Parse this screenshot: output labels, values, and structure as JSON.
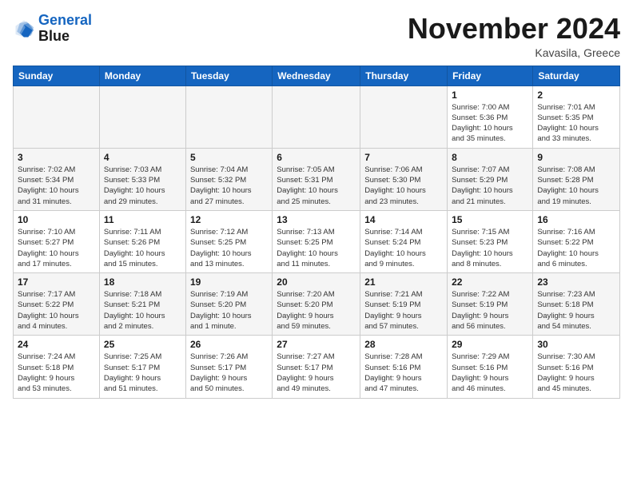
{
  "header": {
    "logo_line1": "General",
    "logo_line2": "Blue",
    "month": "November 2024",
    "location": "Kavasila, Greece"
  },
  "weekdays": [
    "Sunday",
    "Monday",
    "Tuesday",
    "Wednesday",
    "Thursday",
    "Friday",
    "Saturday"
  ],
  "weeks": [
    [
      {
        "day": "",
        "info": ""
      },
      {
        "day": "",
        "info": ""
      },
      {
        "day": "",
        "info": ""
      },
      {
        "day": "",
        "info": ""
      },
      {
        "day": "",
        "info": ""
      },
      {
        "day": "1",
        "info": "Sunrise: 7:00 AM\nSunset: 5:36 PM\nDaylight: 10 hours\nand 35 minutes."
      },
      {
        "day": "2",
        "info": "Sunrise: 7:01 AM\nSunset: 5:35 PM\nDaylight: 10 hours\nand 33 minutes."
      }
    ],
    [
      {
        "day": "3",
        "info": "Sunrise: 7:02 AM\nSunset: 5:34 PM\nDaylight: 10 hours\nand 31 minutes."
      },
      {
        "day": "4",
        "info": "Sunrise: 7:03 AM\nSunset: 5:33 PM\nDaylight: 10 hours\nand 29 minutes."
      },
      {
        "day": "5",
        "info": "Sunrise: 7:04 AM\nSunset: 5:32 PM\nDaylight: 10 hours\nand 27 minutes."
      },
      {
        "day": "6",
        "info": "Sunrise: 7:05 AM\nSunset: 5:31 PM\nDaylight: 10 hours\nand 25 minutes."
      },
      {
        "day": "7",
        "info": "Sunrise: 7:06 AM\nSunset: 5:30 PM\nDaylight: 10 hours\nand 23 minutes."
      },
      {
        "day": "8",
        "info": "Sunrise: 7:07 AM\nSunset: 5:29 PM\nDaylight: 10 hours\nand 21 minutes."
      },
      {
        "day": "9",
        "info": "Sunrise: 7:08 AM\nSunset: 5:28 PM\nDaylight: 10 hours\nand 19 minutes."
      }
    ],
    [
      {
        "day": "10",
        "info": "Sunrise: 7:10 AM\nSunset: 5:27 PM\nDaylight: 10 hours\nand 17 minutes."
      },
      {
        "day": "11",
        "info": "Sunrise: 7:11 AM\nSunset: 5:26 PM\nDaylight: 10 hours\nand 15 minutes."
      },
      {
        "day": "12",
        "info": "Sunrise: 7:12 AM\nSunset: 5:25 PM\nDaylight: 10 hours\nand 13 minutes."
      },
      {
        "day": "13",
        "info": "Sunrise: 7:13 AM\nSunset: 5:25 PM\nDaylight: 10 hours\nand 11 minutes."
      },
      {
        "day": "14",
        "info": "Sunrise: 7:14 AM\nSunset: 5:24 PM\nDaylight: 10 hours\nand 9 minutes."
      },
      {
        "day": "15",
        "info": "Sunrise: 7:15 AM\nSunset: 5:23 PM\nDaylight: 10 hours\nand 8 minutes."
      },
      {
        "day": "16",
        "info": "Sunrise: 7:16 AM\nSunset: 5:22 PM\nDaylight: 10 hours\nand 6 minutes."
      }
    ],
    [
      {
        "day": "17",
        "info": "Sunrise: 7:17 AM\nSunset: 5:22 PM\nDaylight: 10 hours\nand 4 minutes."
      },
      {
        "day": "18",
        "info": "Sunrise: 7:18 AM\nSunset: 5:21 PM\nDaylight: 10 hours\nand 2 minutes."
      },
      {
        "day": "19",
        "info": "Sunrise: 7:19 AM\nSunset: 5:20 PM\nDaylight: 10 hours\nand 1 minute."
      },
      {
        "day": "20",
        "info": "Sunrise: 7:20 AM\nSunset: 5:20 PM\nDaylight: 9 hours\nand 59 minutes."
      },
      {
        "day": "21",
        "info": "Sunrise: 7:21 AM\nSunset: 5:19 PM\nDaylight: 9 hours\nand 57 minutes."
      },
      {
        "day": "22",
        "info": "Sunrise: 7:22 AM\nSunset: 5:19 PM\nDaylight: 9 hours\nand 56 minutes."
      },
      {
        "day": "23",
        "info": "Sunrise: 7:23 AM\nSunset: 5:18 PM\nDaylight: 9 hours\nand 54 minutes."
      }
    ],
    [
      {
        "day": "24",
        "info": "Sunrise: 7:24 AM\nSunset: 5:18 PM\nDaylight: 9 hours\nand 53 minutes."
      },
      {
        "day": "25",
        "info": "Sunrise: 7:25 AM\nSunset: 5:17 PM\nDaylight: 9 hours\nand 51 minutes."
      },
      {
        "day": "26",
        "info": "Sunrise: 7:26 AM\nSunset: 5:17 PM\nDaylight: 9 hours\nand 50 minutes."
      },
      {
        "day": "27",
        "info": "Sunrise: 7:27 AM\nSunset: 5:17 PM\nDaylight: 9 hours\nand 49 minutes."
      },
      {
        "day": "28",
        "info": "Sunrise: 7:28 AM\nSunset: 5:16 PM\nDaylight: 9 hours\nand 47 minutes."
      },
      {
        "day": "29",
        "info": "Sunrise: 7:29 AM\nSunset: 5:16 PM\nDaylight: 9 hours\nand 46 minutes."
      },
      {
        "day": "30",
        "info": "Sunrise: 7:30 AM\nSunset: 5:16 PM\nDaylight: 9 hours\nand 45 minutes."
      }
    ]
  ]
}
